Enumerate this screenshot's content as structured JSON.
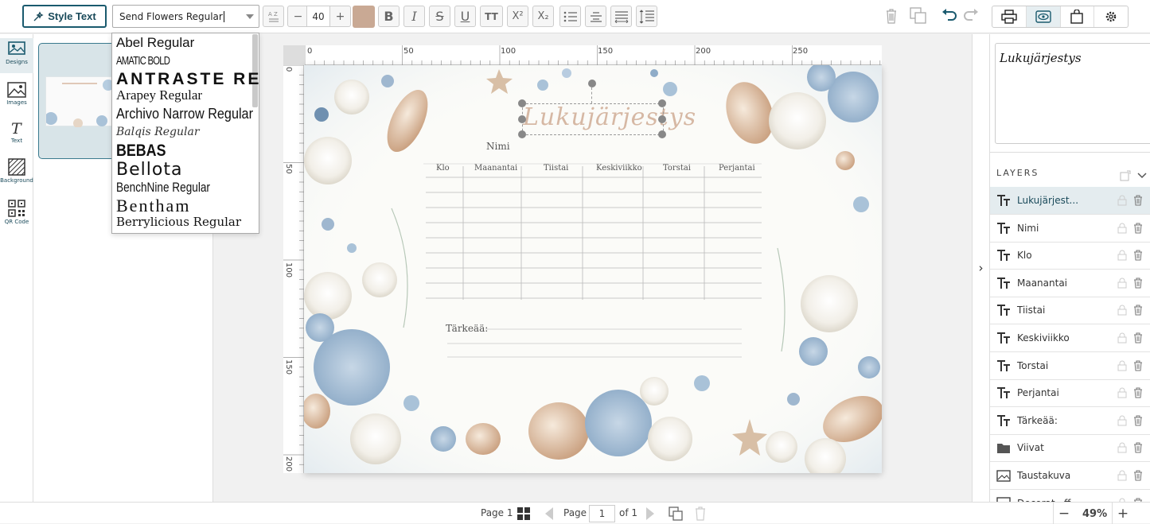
{
  "toolbar": {
    "style_text_label": "Style Text",
    "font_value": "Send Flowers Regular",
    "font_size": "40",
    "text_color": "#c9a994",
    "bold_label": "B",
    "italic_label": "I",
    "strike_label": "S",
    "underline_label": "U",
    "caps_label": "TT",
    "superscript_label": "X²",
    "subscript_label": "X₂"
  },
  "rail": {
    "items": [
      {
        "label": "Designs",
        "icon": "designs-icon"
      },
      {
        "label": "Images",
        "icon": "images-icon"
      },
      {
        "label": "Text",
        "icon": "text-icon"
      },
      {
        "label": "Background",
        "icon": "background-icon"
      },
      {
        "label": "QR Code",
        "icon": "qr-code-icon"
      }
    ]
  },
  "font_dropdown": {
    "options": [
      "Abel Regular",
      "AMATIC BOLD",
      "ANTRASTE REG",
      "Arapey Regular",
      "Archivo Narrow Regular",
      "Balqis Regular",
      "BEBAS",
      "Bellota",
      "BenchNine Regular",
      "Bentham",
      "Berrylicious Regular"
    ]
  },
  "rulers": {
    "top": [
      "0",
      "50",
      "100",
      "150",
      "200",
      "250"
    ],
    "left": [
      "0",
      "50",
      "100",
      "150",
      "200"
    ]
  },
  "sheet": {
    "title": "Lukujärjestys",
    "name_label": "Nimi",
    "columns": [
      "Klo",
      "Maanantai",
      "Tiistai",
      "Keskiviikko",
      "Torstai",
      "Perjantai"
    ],
    "notes_label": "Tärkeää:"
  },
  "right_panel": {
    "preview_text": "Lukujärjestys",
    "layers_title": "LAYERS",
    "layers": [
      {
        "name": "Lukujärjest...",
        "type": "text",
        "active": true
      },
      {
        "name": "Nimi",
        "type": "text"
      },
      {
        "name": "Klo",
        "type": "text"
      },
      {
        "name": "Maanantai",
        "type": "text"
      },
      {
        "name": "Tiistai",
        "type": "text"
      },
      {
        "name": "Keskiviikko",
        "type": "text"
      },
      {
        "name": "Torstai",
        "type": "text"
      },
      {
        "name": "Perjantai",
        "type": "text"
      },
      {
        "name": "Tärkeää:",
        "type": "text"
      },
      {
        "name": "Viivat",
        "type": "folder"
      },
      {
        "name": "Taustakuva",
        "type": "image"
      },
      {
        "name": "Decorat...ff",
        "type": "image"
      }
    ]
  },
  "bottom": {
    "page_label": "Page 1",
    "page_word": "Page",
    "page_value": "1",
    "of_label": "of 1",
    "zoom": "49%"
  },
  "colors": {
    "accent": "#1a5a6e",
    "title_color": "#d6b8a4",
    "active_bg": "#e4ecef"
  }
}
